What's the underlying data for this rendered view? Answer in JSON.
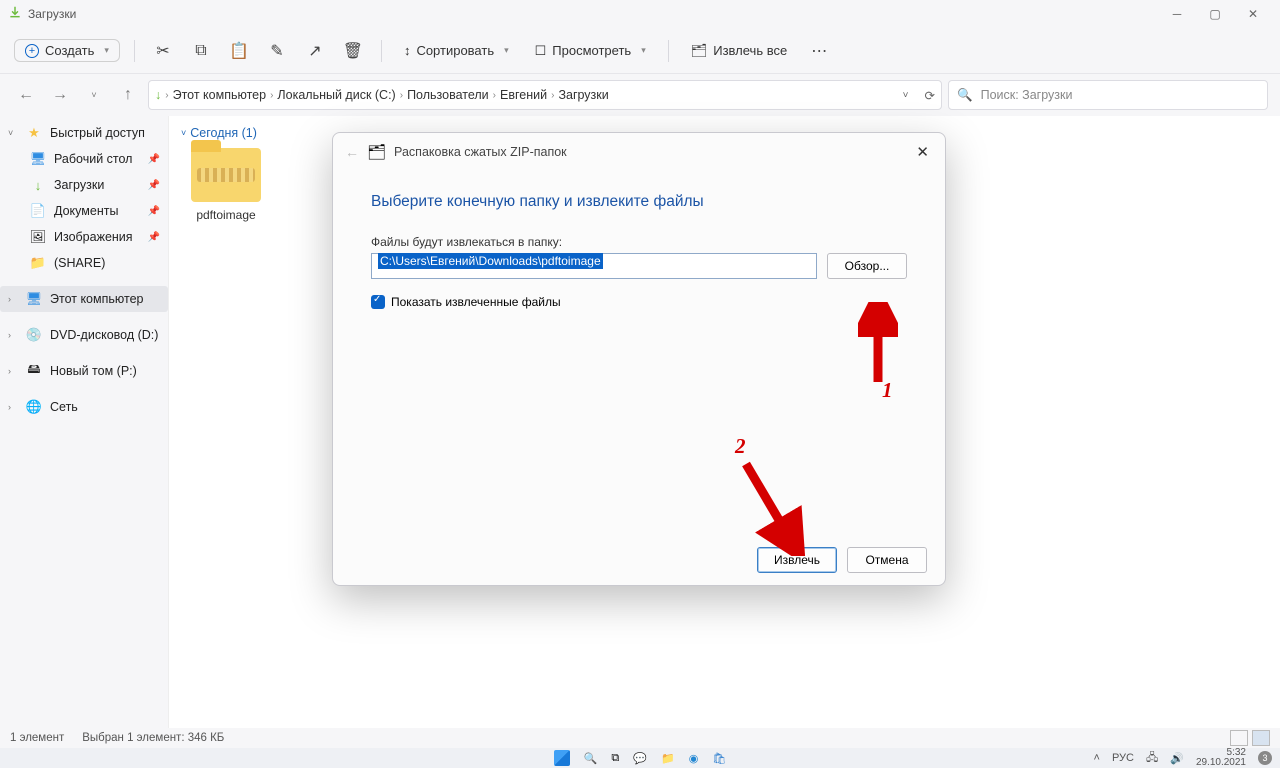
{
  "titlebar": {
    "title": "Загрузки"
  },
  "toolbar": {
    "new_label": "Создать",
    "sort_label": "Сортировать",
    "view_label": "Просмотреть",
    "extract_label": "Извлечь все"
  },
  "breadcrumb": {
    "items": [
      "Этот компьютер",
      "Локальный диск (C:)",
      "Пользователи",
      "Евгений",
      "Загрузки"
    ]
  },
  "search": {
    "placeholder": "Поиск: Загрузки"
  },
  "sidebar": {
    "quick_access": "Быстрый доступ",
    "desktop": "Рабочий стол",
    "downloads": "Загрузки",
    "documents": "Документы",
    "images": "Изображения",
    "share": "(SHARE)",
    "this_pc": "Этот компьютер",
    "dvd": "DVD-дисковод (D:)",
    "volume": "Новый том (P:)",
    "network": "Сеть"
  },
  "content": {
    "group_label": "Сегодня (1)",
    "file_name": "pdftoimage"
  },
  "statusbar": {
    "count": "1 элемент",
    "selection": "Выбран 1 элемент: 346 КБ"
  },
  "dialog": {
    "title": "Распаковка сжатых ZIP-папок",
    "heading": "Выберите конечную папку и извлеките файлы",
    "path_label": "Файлы будут извлекаться в папку:",
    "path_value": "C:\\Users\\Евгений\\Downloads\\pdftoimage",
    "browse": "Обзор...",
    "checkbox": "Показать извлеченные файлы",
    "extract": "Извлечь",
    "cancel": "Отмена"
  },
  "annotations": {
    "num1": "1",
    "num2": "2"
  },
  "taskbar": {
    "lang": "РУС",
    "time": "5:32",
    "date": "29.10.2021",
    "badge": "3"
  }
}
